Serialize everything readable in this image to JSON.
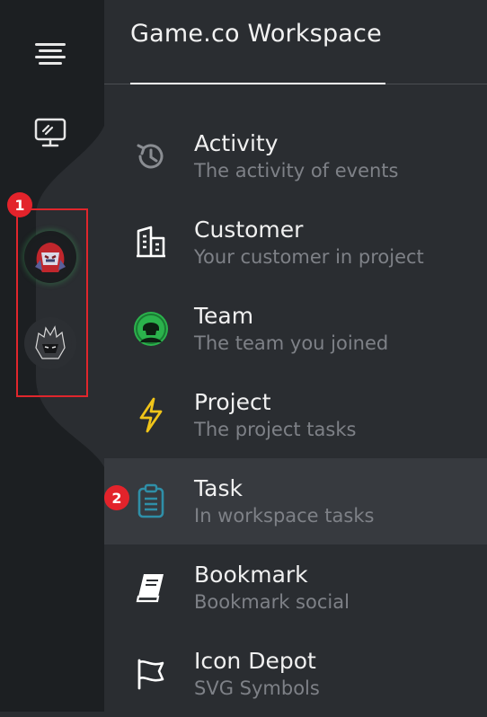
{
  "workspace": {
    "title": "Game.co Workspace"
  },
  "rail": {
    "icons": [
      {
        "name": "menu-icon"
      },
      {
        "name": "monitor-icon"
      }
    ],
    "avatars": [
      {
        "name": "red-knight-avatar"
      },
      {
        "name": "dark-warrior-avatar"
      }
    ],
    "badge_1": "1"
  },
  "menu": [
    {
      "label": "Activity",
      "desc": "The activity of events",
      "icon": "history-icon",
      "color": "#8a8d92"
    },
    {
      "label": "Customer",
      "desc": "Your customer in project",
      "icon": "building-icon",
      "color": "#ffffff"
    },
    {
      "label": "Team",
      "desc": "The team you joined",
      "icon": "team-icon",
      "color": "#2bb24c"
    },
    {
      "label": "Project",
      "desc": "The project tasks",
      "icon": "lightning-icon",
      "color": "#f0c419"
    },
    {
      "label": "Task",
      "desc": "In workspace tasks",
      "icon": "clipboard-icon",
      "color": "#2f8fa8"
    },
    {
      "label": "Bookmark",
      "desc": "Bookmark social",
      "icon": "book-icon",
      "color": "#ffffff"
    },
    {
      "label": "Icon Depot",
      "desc": "SVG Symbols",
      "icon": "flag-icon",
      "color": "#ffffff"
    }
  ],
  "active_item": "Task",
  "badge_2": "2",
  "colors": {
    "rail_bg": "#1c1f22",
    "panel_bg": "#2a2d31",
    "active_bg": "#373a3f",
    "badge_red": "#e3232b"
  }
}
